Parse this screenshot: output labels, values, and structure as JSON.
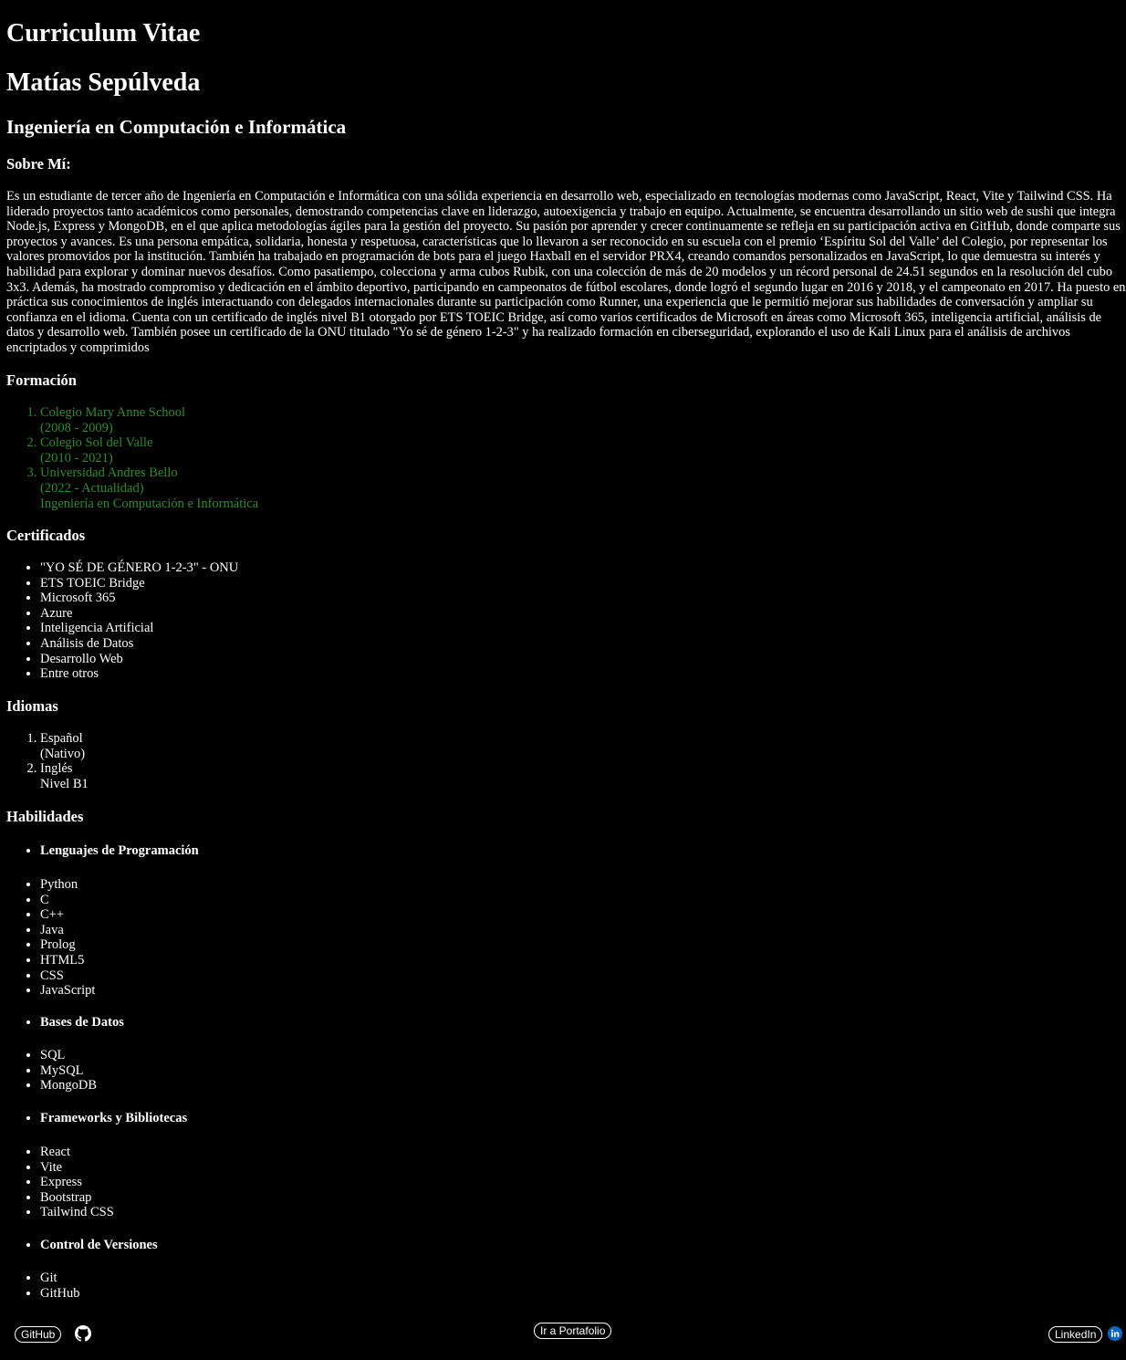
{
  "header": {
    "title": "Curriculum Vitae",
    "name": "Matías Sepúlveda",
    "career": "Ingeniería en Computación e Informática"
  },
  "about": {
    "heading": "Sobre Mí:",
    "text": "Es un estudiante de tercer año de Ingeniería en Computación e Informática con una sólida experiencia en desarrollo web, especializado en tecnologías modernas como JavaScript, React, Vite y Tailwind CSS. Ha liderado proyectos tanto académicos como personales, demostrando competencias clave en liderazgo, autoexigencia y trabajo en equipo. Actualmente, se encuentra desarrollando un sitio web de sushi que integra Node.js, Express y MongoDB, en el que aplica metodologías ágiles para la gestión del proyecto. Su pasión por aprender y crecer continuamente se refleja en su participación activa en GitHub, donde comparte sus proyectos y avances. Es una persona empática, solidaria, honesta y respetuosa, características que lo llevaron a ser reconocido en su escuela con el premio ‘Espíritu Sol del Valle’ del Colegio, por representar los valores promovidos por la institución. También ha trabajado en programación de bots para el juego Haxball en el servidor PRX4, creando comandos personalizados en JavaScript, lo que demuestra su interés y habilidad para explorar y dominar nuevos desafíos. Como pasatiempo, colecciona y arma cubos Rubik, con una colección de más de 20 modelos y un récord personal de 24.51 segundos en la resolución del cubo 3x3. Además, ha mostrado compromiso y dedicación en el ámbito deportivo, participando en campeonatos de fútbol escolares, donde logró el segundo lugar en 2016 y 2018, y el campeonato en 2017. Ha puesto en práctica sus conocimientos de inglés interactuando con delegados internacionales durante su participación como Runner, una experiencia que le permitió mejorar sus habilidades de conversación y ampliar su confianza en el idioma. Cuenta con un certificado de inglés nivel B1 otorgado por ETS TOEIC Bridge, así como varios certificados de Microsoft en áreas como Microsoft 365, inteligencia artificial, análisis de datos y desarrollo web. También posee un certificado de la ONU titulado \"Yo sé de género 1-2-3\" y ha realizado formación en ciberseguridad, explorando el uso de Kali Linux para el análisis de archivos encriptados y comprimidos"
  },
  "education": {
    "heading": "Formación",
    "items": [
      {
        "school": "Colegio Mary Anne School",
        "years": "(2008 - 2009)",
        "detail": ""
      },
      {
        "school": "Colegio Sol del Valle",
        "years": "(2010 - 2021)",
        "detail": ""
      },
      {
        "school": "Universidad Andres Bello",
        "years": "(2022 - Actualidad)",
        "detail": "Ingeniería en Computación e Informática"
      }
    ],
    "color": "#2e8b2e"
  },
  "certificates": {
    "heading": "Certificados",
    "items": [
      "\"YO SÉ DE GÉNERO 1-2-3\" - ONU",
      "ETS TOEIC Bridge",
      "Microsoft 365",
      "Azure",
      "Inteligencia Artificial",
      "Análisis de Datos",
      "Desarrollo Web",
      "Entre otros"
    ]
  },
  "languages": {
    "heading": "Idiomas",
    "items": [
      {
        "name": "Español",
        "level": "(Nativo)"
      },
      {
        "name": "Inglés",
        "level": "Nivel B1"
      }
    ]
  },
  "skills": {
    "heading": "Habilidades",
    "groups": [
      {
        "title": "Lenguajes de Programación",
        "items": [
          "Python",
          "C",
          "C++",
          "Java",
          "Prolog",
          "HTML5",
          "CSS",
          "JavaScript"
        ]
      },
      {
        "title": "Bases de Datos",
        "items": [
          "SQL",
          "MySQL",
          "MongoDB"
        ]
      },
      {
        "title": "Frameworks y Bibliotecas",
        "items": [
          "React",
          "Vite",
          "Express",
          "Bootstrap",
          "Tailwind CSS"
        ]
      },
      {
        "title": "Control de Versiones",
        "items": [
          "Git",
          "GitHub"
        ]
      }
    ]
  },
  "footer": {
    "github_label": "GitHub",
    "github_icon": "github-icon",
    "portfolio_label": "Ir a Portafolio",
    "linkedin_label": "LinkedIn",
    "linkedin_icon": "linkedin-icon",
    "linkedin_color": "#0a66c2"
  }
}
